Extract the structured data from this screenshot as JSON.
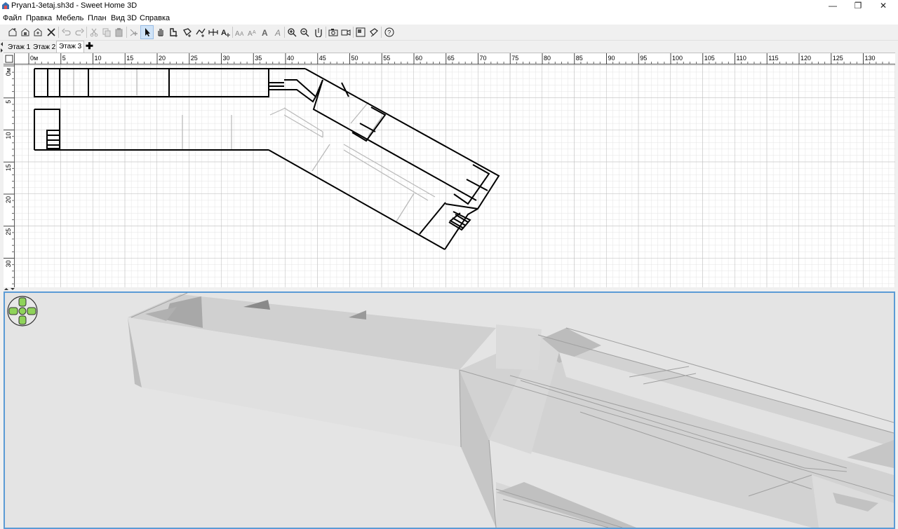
{
  "window": {
    "title": "Pryan1-3etaj.sh3d - Sweet Home 3D",
    "controls": {
      "minimize": "—",
      "restore": "❐",
      "close": "✕"
    }
  },
  "menu": {
    "items": [
      "Файл",
      "Правка",
      "Мебель",
      "План",
      "Вид 3D",
      "Справка"
    ]
  },
  "toolbar": {
    "buttons": [
      "new-home-icon",
      "open-icon",
      "save-icon",
      "cut-tool-icon",
      "undo-icon",
      "redo-icon",
      "cut-icon",
      "copy-icon",
      "paste-icon",
      "add-furniture-icon",
      "select-arrow-icon",
      "pan-hand-icon",
      "create-walls-icon",
      "create-rooms-icon",
      "create-polylines-icon",
      "create-dimensions-icon",
      "add-text-icon",
      "increase-text-icon",
      "decrease-text-icon",
      "bold-text-icon",
      "italic-text-icon",
      "zoom-in-icon",
      "zoom-out-icon",
      "import-background-icon",
      "photo-icon",
      "video-icon",
      "preferences-icon",
      "edit-icon",
      "help-icon"
    ],
    "active": "select-arrow-icon"
  },
  "levels": {
    "tabs": [
      "Этаж 1",
      "Этаж 2",
      "Этаж 3"
    ],
    "selected": "Этаж 3",
    "add_symbol": "✚"
  },
  "plan": {
    "ruler_h_labels": [
      "0м",
      "5",
      "10",
      "15",
      "20",
      "25",
      "30",
      "35",
      "40",
      "45",
      "50",
      "55",
      "60",
      "65",
      "70",
      "75",
      "80",
      "85",
      "90",
      "95",
      "100",
      "105",
      "110",
      "115",
      "120",
      "125",
      "130"
    ],
    "ruler_v_labels": [
      "0м",
      "5",
      "10",
      "15",
      "20",
      "25",
      "30"
    ]
  },
  "view3d": {
    "navigator": "navigation-arrows-icon"
  }
}
